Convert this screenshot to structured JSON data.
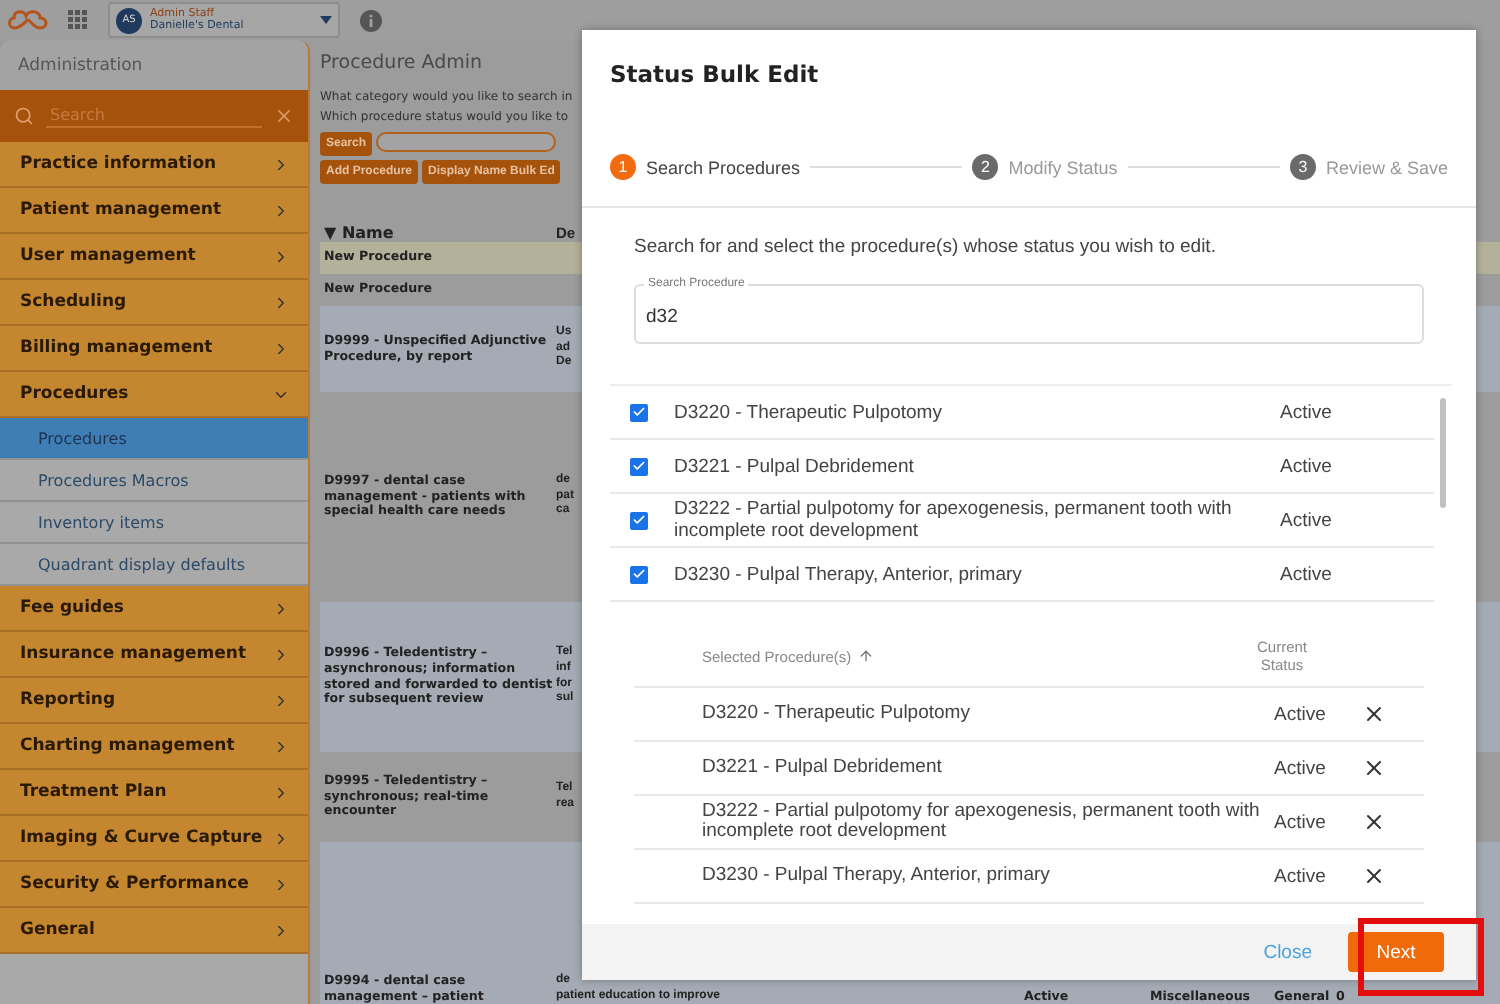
{
  "topbar": {
    "avatar_initials": "AS",
    "user_name": "Admin Staff",
    "practice": "Danielle's Dental"
  },
  "sidebar": {
    "title": "Administration",
    "search_placeholder": "Search",
    "items": [
      {
        "label": "Practice information",
        "expanded": false
      },
      {
        "label": "Patient management",
        "expanded": false
      },
      {
        "label": "User management",
        "expanded": false
      },
      {
        "label": "Scheduling",
        "expanded": false
      },
      {
        "label": "Billing management",
        "expanded": false
      },
      {
        "label": "Procedures",
        "expanded": true,
        "children": [
          {
            "label": "Procedures",
            "selected": true
          },
          {
            "label": "Procedures Macros",
            "selected": false
          },
          {
            "label": "Inventory items",
            "selected": false
          },
          {
            "label": "Quadrant display defaults",
            "selected": false
          }
        ]
      },
      {
        "label": "Fee guides",
        "expanded": false
      },
      {
        "label": "Insurance management",
        "expanded": false
      },
      {
        "label": "Reporting",
        "expanded": false
      },
      {
        "label": "Charting management",
        "expanded": false
      },
      {
        "label": "Treatment Plan",
        "expanded": false
      },
      {
        "label": "Imaging & Curve Capture",
        "expanded": false
      },
      {
        "label": "Security & Performance",
        "expanded": false
      },
      {
        "label": "General",
        "expanded": false
      }
    ]
  },
  "main": {
    "title": "Procedure Admin",
    "prompts": [
      "What category would you like to search in",
      "Which procedure status would you like to"
    ],
    "search_button": "Search",
    "buttons": [
      "Add Procedure",
      "Display Name Bulk Ed"
    ],
    "columns": [
      "▼ Name",
      "De"
    ],
    "rows": [
      {
        "name": "New Procedure",
        "column_2": [],
        "kind": "highlight"
      },
      {
        "name": "New Procedure",
        "column_2": [],
        "kind": "plain"
      },
      {
        "name": "D9999 - Unspecified Adjunctive Procedure, by report",
        "column_2": [
          "Us",
          "ad",
          "De"
        ],
        "kind": "tinted"
      },
      {
        "name": "D9997 - dental case management - patients with special health care needs",
        "column_2": [
          "de",
          "pat",
          "ca"
        ],
        "kind": "plain"
      },
      {
        "name": "D9996 - Teledentistry – asynchronous; information stored and forwarded to dentist for subsequent review",
        "column_2": [
          "Tel",
          "inf",
          "for",
          "sul"
        ],
        "kind": "tinted"
      },
      {
        "name": "D9995 - Teledentistry – synchronous; real-time encounter",
        "column_2": [
          "Tel",
          "rea"
        ],
        "kind": "plain"
      },
      {
        "name": "D9994 - dental case management – patient",
        "column_2": [
          "de",
          "patient education to improve"
        ],
        "kind": "tinted",
        "status": "Active",
        "column_4": "Miscellaneous",
        "column_5": "General",
        "column_6": "0"
      }
    ]
  },
  "modal": {
    "title": "Status Bulk Edit",
    "steps": [
      {
        "number": "1",
        "label": "Search Procedures",
        "selected": true
      },
      {
        "number": "2",
        "label": "Modify Status",
        "selected": false
      },
      {
        "number": "3",
        "label": "Review & Save",
        "selected": false
      }
    ],
    "instructions": "Search for and select the procedure(s) whose status you wish to edit.",
    "search": {
      "label": "Search Procedure",
      "value": "d32"
    },
    "results": [
      {
        "label": "D3220 - Therapeutic Pulpotomy",
        "checked": true,
        "status": "Active"
      },
      {
        "label": "D3221 - Pulpal Debridement",
        "checked": true,
        "status": "Active"
      },
      {
        "label": "D3222 - Partial pulpotomy for apexogenesis, permanent tooth with incomplete root development",
        "checked": true,
        "status": "Active"
      },
      {
        "label": "D3230 - Pulpal Therapy, Anterior, primary",
        "checked": true,
        "status": "Active"
      }
    ],
    "selected_table": {
      "columns": [
        "Selected Procedure(s)",
        "Current Status"
      ],
      "rows": [
        {
          "label": "D3220 - Therapeutic Pulpotomy",
          "status": "Active"
        },
        {
          "label": "D3221 - Pulpal Debridement",
          "status": "Active"
        },
        {
          "label": "D3222 - Partial pulpotomy for apexogenesis, permanent tooth with incomplete root development",
          "status": "Active"
        },
        {
          "label": "D3230 - Pulpal Therapy, Anterior, primary",
          "status": "Active"
        }
      ]
    },
    "close": "Close",
    "next": {
      "label": "Next",
      "highlighted": true
    }
  }
}
